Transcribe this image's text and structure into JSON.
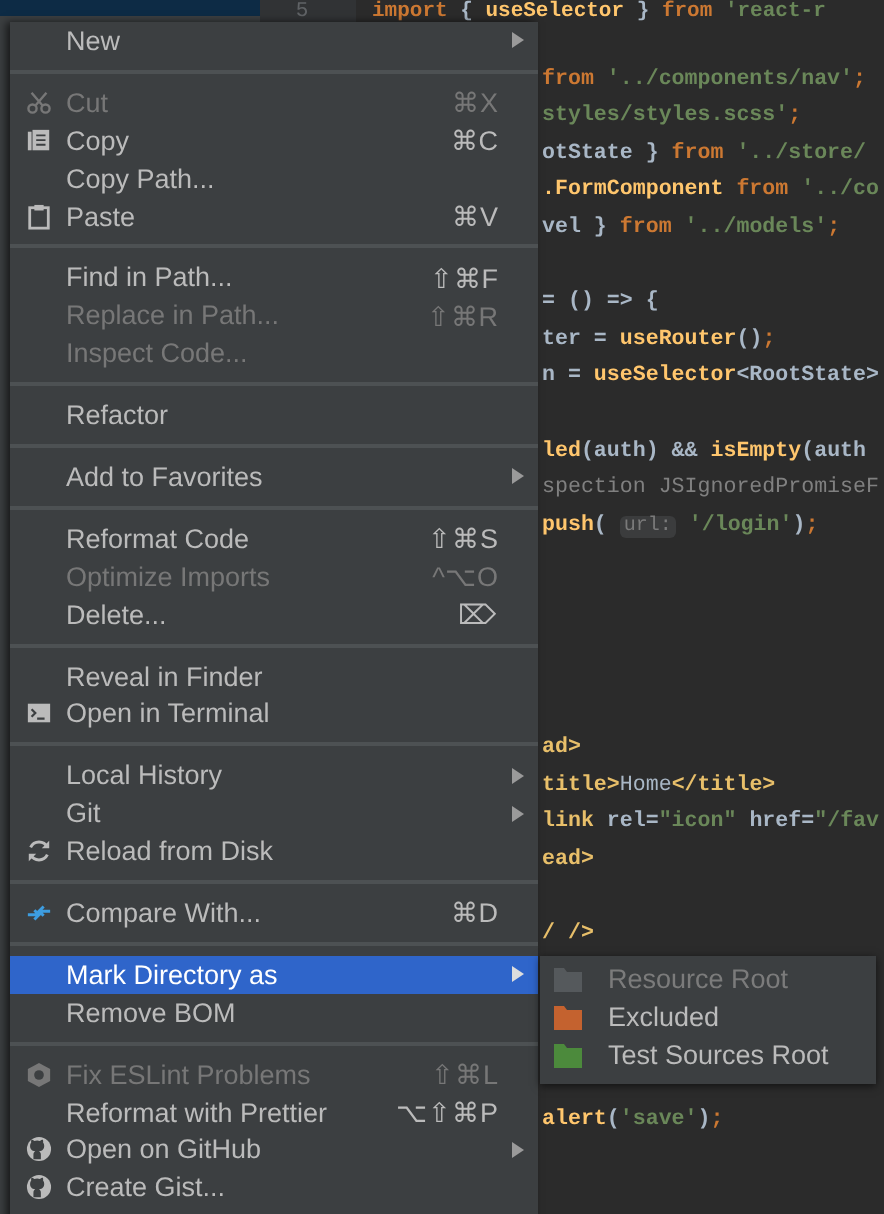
{
  "editor": {
    "line_number": "5",
    "lines": [
      {
        "kind": "top",
        "segments": [
          {
            "kind": "kw",
            "text": "import"
          },
          {
            "kind": "plain",
            "text": " { "
          },
          {
            "kind": "func",
            "text": "useSelector"
          },
          {
            "kind": "plain",
            "text": " } "
          },
          {
            "kind": "kw",
            "text": "from"
          },
          {
            "kind": "str",
            "text": " 'react-r"
          }
        ]
      },
      {
        "kind": "blank"
      },
      {
        "kind": "code",
        "segments": [
          {
            "kind": "kw",
            "text": "from"
          },
          {
            "kind": "str",
            "text": " '../components/nav'"
          },
          {
            "kind": "kw",
            "text": ";"
          }
        ]
      },
      {
        "kind": "code",
        "segments": [
          {
            "kind": "str",
            "text": "styles/styles.scss'"
          },
          {
            "kind": "kw",
            "text": ";"
          }
        ]
      },
      {
        "kind": "code",
        "segments": [
          {
            "kind": "plain",
            "text": "otState } "
          },
          {
            "kind": "kw",
            "text": "from"
          },
          {
            "kind": "str",
            "text": " '../store/"
          }
        ]
      },
      {
        "kind": "code",
        "segments": [
          {
            "kind": "func",
            "text": ".FormComponent"
          },
          {
            "kind": "kw",
            "text": " from"
          },
          {
            "kind": "str",
            "text": " '../co"
          }
        ]
      },
      {
        "kind": "code",
        "segments": [
          {
            "kind": "plain",
            "text": "vel } "
          },
          {
            "kind": "kw",
            "text": "from"
          },
          {
            "kind": "str",
            "text": " '../models'"
          },
          {
            "kind": "kw",
            "text": ";"
          }
        ]
      },
      {
        "kind": "blank"
      },
      {
        "kind": "code",
        "segments": [
          {
            "kind": "plain",
            "text": "= () => {"
          }
        ]
      },
      {
        "kind": "code",
        "segments": [
          {
            "kind": "plain",
            "text": "ter = "
          },
          {
            "kind": "func",
            "text": "useRouter"
          },
          {
            "kind": "plain",
            "text": "()"
          },
          {
            "kind": "kw",
            "text": ";"
          }
        ]
      },
      {
        "kind": "code",
        "segments": [
          {
            "kind": "plain",
            "text": "n = "
          },
          {
            "kind": "func",
            "text": "useSelector"
          },
          {
            "kind": "plain",
            "text": "<RootState>"
          }
        ]
      },
      {
        "kind": "blank"
      },
      {
        "kind": "code",
        "segments": [
          {
            "kind": "func",
            "text": "led"
          },
          {
            "kind": "plain",
            "text": "(auth) && "
          },
          {
            "kind": "func",
            "text": "isEmpty"
          },
          {
            "kind": "plain",
            "text": "(auth"
          }
        ]
      },
      {
        "kind": "code",
        "segments": [
          {
            "kind": "comment",
            "text": "spection JSIgnoredPromiseF"
          }
        ]
      },
      {
        "kind": "code",
        "segments": [
          {
            "kind": "func",
            "text": "push"
          },
          {
            "kind": "plain",
            "text": "( "
          },
          {
            "kind": "hint",
            "text": "url:"
          },
          {
            "kind": "str",
            "text": " '/login'"
          },
          {
            "kind": "plain",
            "text": ")"
          },
          {
            "kind": "kw",
            "text": ";"
          }
        ]
      },
      {
        "kind": "blank"
      },
      {
        "kind": "blank"
      },
      {
        "kind": "blank"
      },
      {
        "kind": "blank"
      },
      {
        "kind": "blank"
      },
      {
        "kind": "code",
        "segments": [
          {
            "kind": "tag",
            "text": "ad>"
          }
        ]
      },
      {
        "kind": "code",
        "segments": [
          {
            "kind": "tag",
            "text": "title>"
          },
          {
            "kind": "text",
            "text": "Home"
          },
          {
            "kind": "tag",
            "text": "</title>"
          }
        ]
      },
      {
        "kind": "code",
        "segments": [
          {
            "kind": "tag",
            "text": "link"
          },
          {
            "kind": "plain",
            "text": " rel="
          },
          {
            "kind": "str",
            "text": "\"icon\""
          },
          {
            "kind": "plain",
            "text": " href="
          },
          {
            "kind": "str",
            "text": "\"/fav"
          }
        ]
      },
      {
        "kind": "code",
        "segments": [
          {
            "kind": "tag",
            "text": "ead>"
          }
        ]
      },
      {
        "kind": "blank"
      },
      {
        "kind": "code",
        "segments": [
          {
            "kind": "tag",
            "text": "/ />"
          }
        ]
      },
      {
        "kind": "blank"
      },
      {
        "kind": "blank"
      },
      {
        "kind": "blank"
      },
      {
        "kind": "blank"
      },
      {
        "kind": "code",
        "segments": [
          {
            "kind": "func",
            "text": "alert"
          },
          {
            "kind": "plain",
            "text": "("
          },
          {
            "kind": "str",
            "text": "'save'"
          },
          {
            "kind": "plain",
            "text": ")"
          },
          {
            "kind": "kw",
            "text": ";"
          }
        ]
      }
    ]
  },
  "context_menu": {
    "items": [
      {
        "kind": "item",
        "label": "New",
        "submenu": true,
        "disabled": false,
        "selected": false
      },
      {
        "kind": "separator"
      },
      {
        "kind": "cut",
        "label": "Cut",
        "shortcut": "⌘X",
        "submenu": false,
        "disabled": true,
        "selected": false
      },
      {
        "kind": "copy",
        "label": "Copy",
        "shortcut": "⌘C",
        "submenu": false,
        "disabled": false,
        "selected": false
      },
      {
        "kind": "item",
        "label": "Copy Path...",
        "submenu": false,
        "disabled": false,
        "selected": false
      },
      {
        "kind": "paste",
        "label": "Paste",
        "shortcut": "⌘V",
        "submenu": false,
        "disabled": false,
        "selected": false
      },
      {
        "kind": "separator"
      },
      {
        "kind": "item",
        "label": "Find in Path...",
        "shortcut": "⇧⌘F",
        "submenu": false,
        "disabled": false,
        "selected": false
      },
      {
        "kind": "item",
        "label": "Replace in Path...",
        "shortcut": "⇧⌘R",
        "submenu": false,
        "disabled": true,
        "selected": false
      },
      {
        "kind": "item",
        "label": "Inspect Code...",
        "submenu": false,
        "disabled": true,
        "selected": false
      },
      {
        "kind": "separator"
      },
      {
        "kind": "item",
        "label": "Refactor",
        "submenu": false,
        "disabled": false,
        "selected": false
      },
      {
        "kind": "separator"
      },
      {
        "kind": "item",
        "label": "Add to Favorites",
        "submenu": true,
        "disabled": false,
        "selected": false
      },
      {
        "kind": "separator"
      },
      {
        "kind": "item",
        "label": "Reformat Code",
        "shortcut": "⇧⌘S",
        "submenu": false,
        "disabled": false,
        "selected": false
      },
      {
        "kind": "item",
        "label": "Optimize Imports",
        "shortcut": "^⌥O",
        "submenu": false,
        "disabled": true,
        "selected": false
      },
      {
        "kind": "item",
        "label": "Delete...",
        "shortcut": "⌦",
        "submenu": false,
        "disabled": false,
        "selected": false
      },
      {
        "kind": "separator"
      },
      {
        "kind": "item",
        "label": "Reveal in Finder",
        "submenu": false,
        "disabled": false,
        "selected": false
      },
      {
        "kind": "terminal",
        "label": "Open in Terminal",
        "submenu": false,
        "disabled": false,
        "selected": false
      },
      {
        "kind": "separator"
      },
      {
        "kind": "item",
        "label": "Local History",
        "submenu": true,
        "disabled": false,
        "selected": false
      },
      {
        "kind": "item",
        "label": "Git",
        "submenu": true,
        "disabled": false,
        "selected": false
      },
      {
        "kind": "reload",
        "label": "Reload from Disk",
        "submenu": false,
        "disabled": false,
        "selected": false
      },
      {
        "kind": "separator"
      },
      {
        "kind": "compare",
        "label": "Compare With...",
        "shortcut": "⌘D",
        "submenu": false,
        "disabled": false,
        "selected": false
      },
      {
        "kind": "separator"
      },
      {
        "kind": "item",
        "label": "Mark Directory as",
        "submenu": true,
        "disabled": false,
        "selected": true
      },
      {
        "kind": "item",
        "label": "Remove BOM",
        "submenu": false,
        "disabled": false,
        "selected": false
      },
      {
        "kind": "separator"
      },
      {
        "kind": "eslint",
        "label": "Fix ESLint Problems",
        "shortcut": "⇧⌘L",
        "submenu": false,
        "disabled": true,
        "selected": false
      },
      {
        "kind": "item",
        "label": "Reformat with Prettier",
        "shortcut": "⌥⇧⌘P",
        "submenu": false,
        "disabled": false,
        "selected": false
      },
      {
        "kind": "github",
        "label": "Open on GitHub",
        "submenu": true,
        "disabled": false,
        "selected": false
      },
      {
        "kind": "github",
        "label": "Create Gist...",
        "submenu": false,
        "disabled": false,
        "selected": false
      }
    ]
  },
  "submenu": {
    "items": [
      {
        "label": "Resource Root",
        "color": "#55595c",
        "disabled": true,
        "selected": false
      },
      {
        "label": "Excluded",
        "color": "#c4622f",
        "disabled": false,
        "selected": false
      },
      {
        "label": "Test Sources Root",
        "color": "#4c8a3c",
        "disabled": false,
        "selected": false
      }
    ]
  }
}
